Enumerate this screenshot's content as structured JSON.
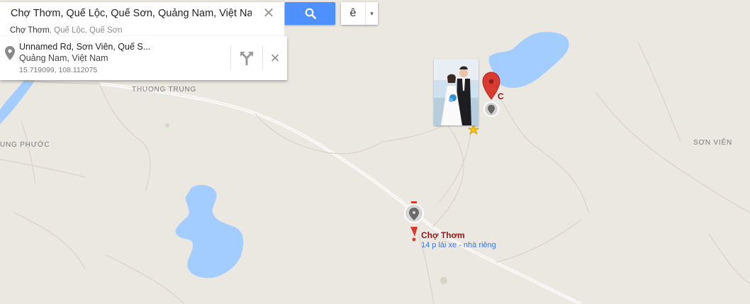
{
  "search": {
    "query": "Chợ Thơm, Quế Lộc, Quế Sơn, Quảng Nam, Việt Nam",
    "clear_icon": "close-icon",
    "button_icon": "search-icon"
  },
  "language": {
    "letter": "ê",
    "arrow": "▾"
  },
  "suggestion": {
    "name": "Chợ Thơm",
    "detail": ", Quế Lộc, Quế Sơn"
  },
  "info_card": {
    "line1": "Unnamed Rd, Sơn Viên, Quế S...",
    "line2": "Quảng Nam, Việt Nam",
    "coords": "15.719099, 108.112075",
    "close": "×"
  },
  "map_labels": {
    "thuong_trung": "THUONG TRUNG",
    "son_vien": "SƠN VIÊN",
    "phuoc": "UNG PHƯỚC"
  },
  "place": {
    "name": "Chợ Thơm",
    "sub": "14 p lái xe - nhà riêng"
  },
  "clipped_label": "C",
  "colors": {
    "water": "#a3ccff",
    "map_bg": "#ebe7e1",
    "road": "#ffffff",
    "accent": "#4d90fe",
    "pin": "#d93b30"
  }
}
